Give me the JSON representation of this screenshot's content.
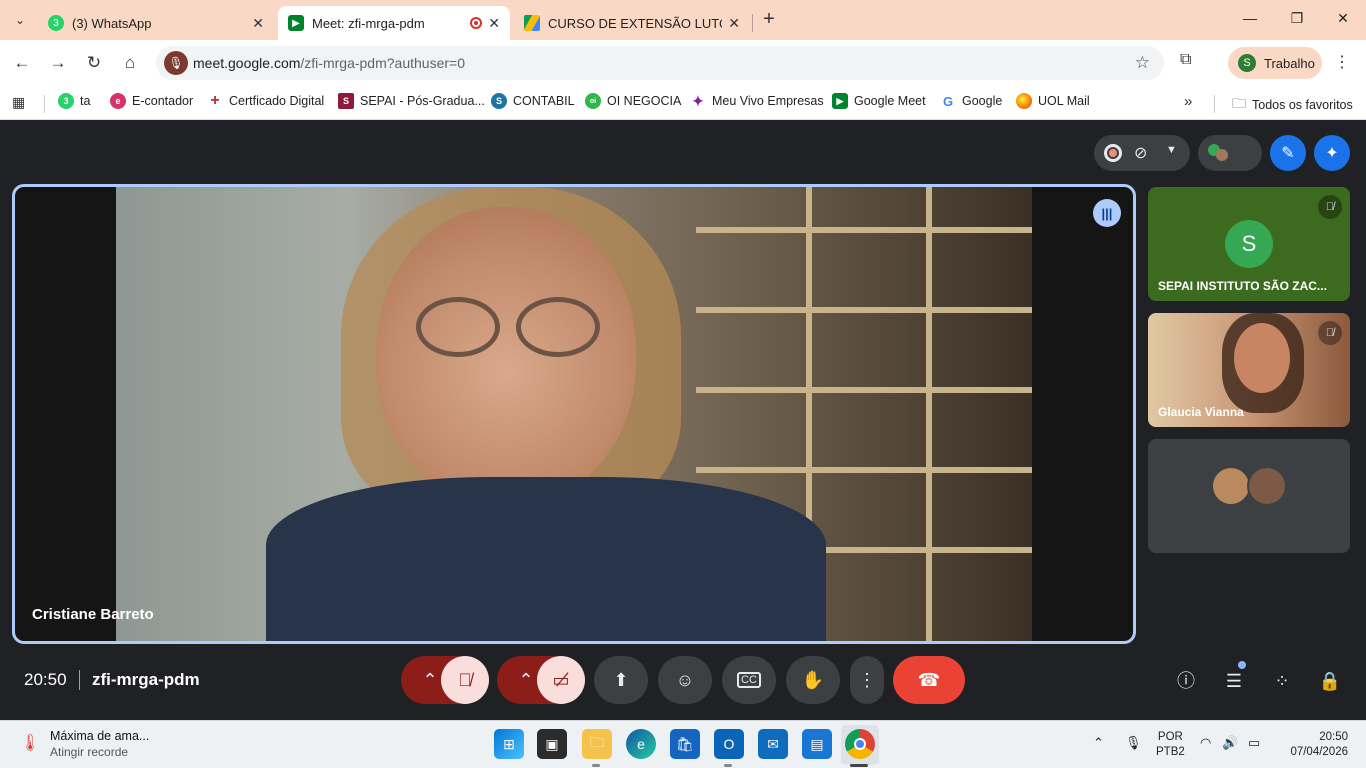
{
  "browser": {
    "tabs": [
      {
        "title": "(3) WhatsApp",
        "favicon": "whatsapp-icon",
        "favicon_text": "3",
        "color": "#25d366"
      },
      {
        "title": "Meet: zfi-mrga-pdm",
        "favicon": "google-meet-icon",
        "color": "#00832d",
        "recording": true
      },
      {
        "title": "CURSO DE EXTENSÃO LUTO E M",
        "favicon": "google-drive-icon",
        "color": "#fbbc04"
      }
    ],
    "url_host": "meet.google.com",
    "url_path": "/zfi-mrga-pdm?authuser=0",
    "profile_initial": "S",
    "profile_name": "Trabalho"
  },
  "bookmarks": [
    {
      "label": "ta",
      "icon": "whatsapp-icon",
      "icon_text": "3",
      "color": "#25d366"
    },
    {
      "label": "E-contador",
      "icon": "e-contador-icon",
      "icon_text": "e",
      "color": "#d6336c"
    },
    {
      "label": "Certficado Digital",
      "icon": "certificate-icon",
      "icon_text": "+",
      "color": "#c62828"
    },
    {
      "label": "SEPAI - Pós-Gradua...",
      "icon": "sepai-icon",
      "icon_text": "S",
      "color": "#8e1b3a"
    },
    {
      "label": "CONTABIL",
      "icon": "contabil-icon",
      "icon_text": "S",
      "color": "#1976a5"
    },
    {
      "label": "OI NEGOCIA",
      "icon": "oi-icon",
      "icon_text": "oi",
      "color": "#2db84b"
    },
    {
      "label": "Meu Vivo Empresas",
      "icon": "vivo-icon",
      "icon_text": "✦",
      "color": "#7b1fa2"
    },
    {
      "label": "Google Meet",
      "icon": "google-meet-icon",
      "icon_text": "▶",
      "color": "#00832d"
    },
    {
      "label": "Google",
      "icon": "google-icon",
      "icon_text": "G",
      "color": "#4285f4"
    },
    {
      "label": "UOL Mail",
      "icon": "uol-icon",
      "icon_text": "",
      "color": "#f57c00"
    }
  ],
  "all_bookmarks_label": "Todos os favoritos",
  "meet": {
    "main_participant": "Cristiane Barreto",
    "participants": [
      {
        "name": "SEPAI INSTITUTO SÃO ZAC...",
        "initial": "S",
        "muted": true
      },
      {
        "name": "Glaucia Vianna",
        "muted": true
      },
      {
        "name": "",
        "others": true
      }
    ],
    "time": "20:50",
    "meeting_code": "zfi-mrga-pdm",
    "controls": [
      "mic-options",
      "mic-off",
      "camera-options",
      "camera-off",
      "present",
      "emoji",
      "captions",
      "raise-hand",
      "more-options",
      "leave-call"
    ],
    "accent": "#aecbfa",
    "leave_color": "#ea4335"
  },
  "taskbar": {
    "weather_title": "Máxima de ama...",
    "weather_sub": "Atingir recorde",
    "lang_line1": "POR",
    "lang_line2": "PTB2",
    "clock_time": "20:50",
    "clock_date": "07/04/2026"
  }
}
